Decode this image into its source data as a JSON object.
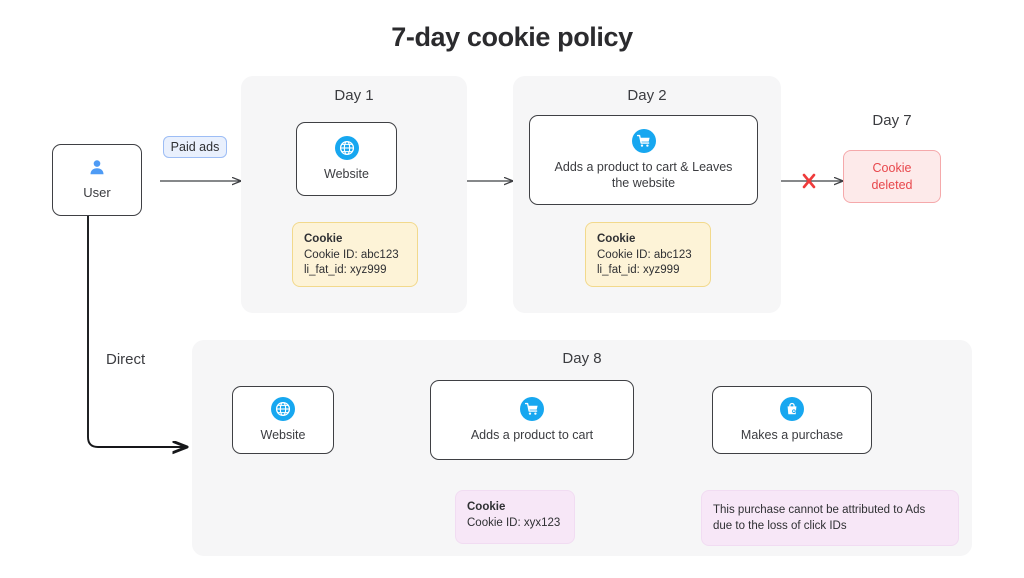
{
  "title": "7-day cookie policy",
  "colors": {
    "accent_blue": "#17a7f0",
    "panel_bg": "#f6f6f7",
    "cookie_yellow": "#fdf3d7",
    "cookie_pink": "#f7e7f7",
    "deleted_red_bg": "#fdeaea",
    "deleted_red_text": "#e8474c",
    "pill_blue_bg": "#e9f0fd",
    "stroke_dark": "#3f4044"
  },
  "user": {
    "label": "User",
    "icon": "user-icon"
  },
  "edges": {
    "paid_ads_label": "Paid ads",
    "direct_label": "Direct"
  },
  "panels": [
    {
      "id": "day1",
      "title": "Day 1",
      "node": {
        "icon": "globe-icon",
        "label": "Website"
      },
      "cookie": {
        "title": "Cookie",
        "lines": [
          "Cookie ID: abc123",
          "li_fat_id: xyz999"
        ]
      }
    },
    {
      "id": "day2",
      "title": "Day 2",
      "node": {
        "icon": "shopping-cart-icon",
        "label": "Adds a product to cart & Leaves the website"
      },
      "cookie": {
        "title": "Cookie",
        "lines": [
          "Cookie ID: abc123",
          "li_fat_id: xyz999"
        ]
      }
    }
  ],
  "day7": {
    "title": "Day 7",
    "status": "Cookie deleted"
  },
  "day8": {
    "title": "Day 8",
    "nodes": [
      {
        "icon": "globe-icon",
        "label": "Website"
      },
      {
        "icon": "shopping-cart-icon",
        "label": "Adds a product to cart"
      },
      {
        "icon": "shopping-bag-icon",
        "label": "Makes a purchase"
      }
    ],
    "cookie": {
      "title": "Cookie",
      "lines": [
        "Cookie ID: xyx123"
      ]
    },
    "note": "This purchase cannot be attributed to Ads due to the loss of click IDs"
  }
}
